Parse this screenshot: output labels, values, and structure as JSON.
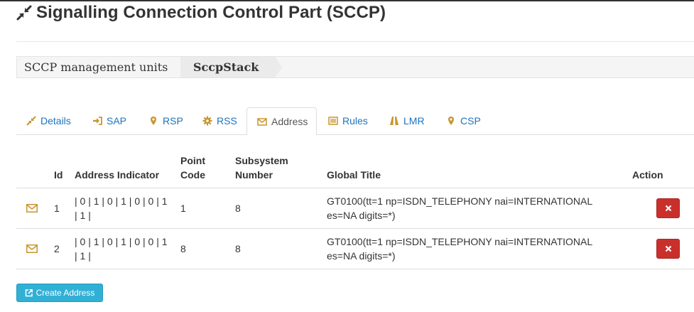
{
  "page": {
    "title": "Signalling Connection Control Part (SCCP)",
    "title_icon": "compress-arrows-icon"
  },
  "breadcrumb": {
    "items": [
      "SCCP management units",
      "SccpStack"
    ]
  },
  "tabs": [
    {
      "label": "Details",
      "icon": "compress-arrows-icon",
      "active": false
    },
    {
      "label": "SAP",
      "icon": "sign-in-icon",
      "active": false
    },
    {
      "label": "RSP",
      "icon": "map-marker-icon",
      "active": false
    },
    {
      "label": "RSS",
      "icon": "gear-icon",
      "active": false
    },
    {
      "label": "Address",
      "icon": "envelope-icon",
      "active": true
    },
    {
      "label": "Rules",
      "icon": "list-icon",
      "active": false
    },
    {
      "label": "LMR",
      "icon": "road-icon",
      "active": false
    },
    {
      "label": "CSP",
      "icon": "map-marker-icon",
      "active": false
    }
  ],
  "table": {
    "headers": {
      "id": "Id",
      "address_indicator": "Address Indicator",
      "point_code": "Point Code",
      "subsystem_number": "Subsystem Number",
      "global_title": "Global Title",
      "action": "Action"
    },
    "rows": [
      {
        "id": "1",
        "address_indicator": "| 0 | 1 | 0 | 1 | 0 | 0 | 1 | 1 |",
        "point_code": "1",
        "subsystem_number": "8",
        "global_title": "GT0100(tt=1 np=ISDN_TELEPHONY nai=INTERNATIONAL es=NA digits=*)"
      },
      {
        "id": "2",
        "address_indicator": "| 0 | 1 | 0 | 1 | 0 | 0 | 1 | 1 |",
        "point_code": "8",
        "subsystem_number": "8",
        "global_title": "GT0100(tt=1 np=ISDN_TELEPHONY nai=INTERNATIONAL es=NA digits=*)"
      }
    ],
    "delete_icon": "times-icon"
  },
  "actions": {
    "create_label": "Create Address",
    "create_icon": "external-link-icon"
  },
  "colors": {
    "link": "#1e73be",
    "icon_gold": "#c8962e",
    "danger": "#c9302c",
    "info": "#31b0d5"
  }
}
